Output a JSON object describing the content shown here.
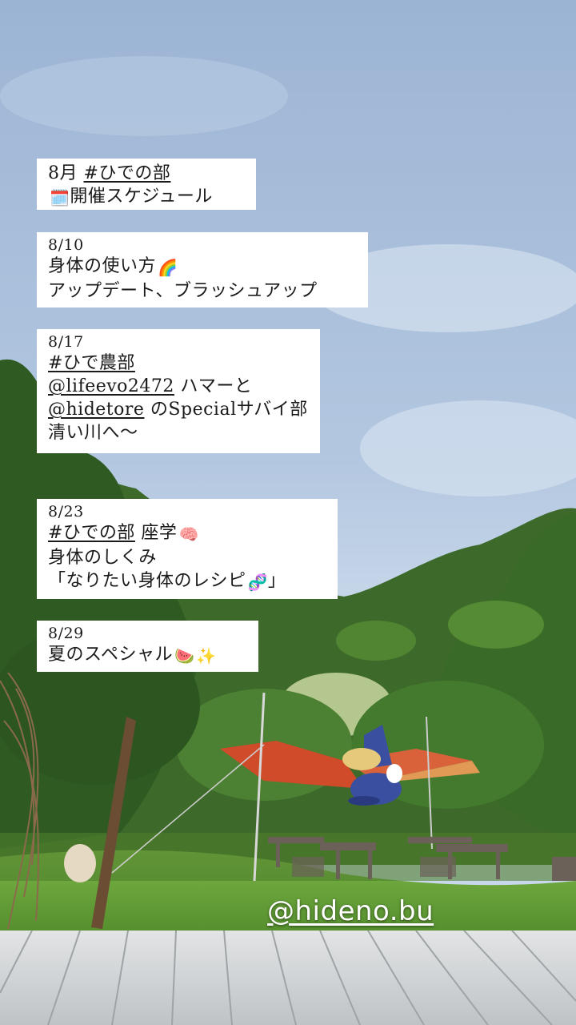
{
  "header": {
    "line1_prefix": "8月 ",
    "line1_tag": "#ひでの部",
    "line2": "開催スケジュール",
    "icon": "calendar-icon"
  },
  "events": [
    {
      "date": "8/10",
      "line1": "身体の使い方",
      "line1_icon": "rainbow-icon",
      "line2": "アップデート、ブラッシュアップ"
    },
    {
      "date": "8/17",
      "tag": "#ひで農部",
      "line2_handle": "@lifeevo2472",
      "line2_rest": " ハマーと",
      "line3_handle": "@hidetore",
      "line3_rest": " のSpecialサバイ部",
      "line4": "清い川へ〜"
    },
    {
      "date": "8/23",
      "tag": "#ひでの部",
      "line1_rest": " 座学",
      "line1_icon": "brain-icon",
      "line2": "身体のしくみ",
      "line3": "「なりたい身体のレシピ",
      "line3_icon": "dna-icon",
      "line3_end": "」"
    },
    {
      "date": "8/29",
      "line1": "夏のスペシャル",
      "line1_icons": [
        "watermelon-icon",
        "sparkles-icon"
      ]
    }
  ],
  "watermark": "@hideno.bu",
  "colors": {
    "sky_top": "#9fb7d6",
    "sky_bottom": "#c9d9ea",
    "forest": "#3f6b2c",
    "lawn": "#6aa23c",
    "tarp": "#d4502c",
    "deck": "#d9dcde"
  }
}
